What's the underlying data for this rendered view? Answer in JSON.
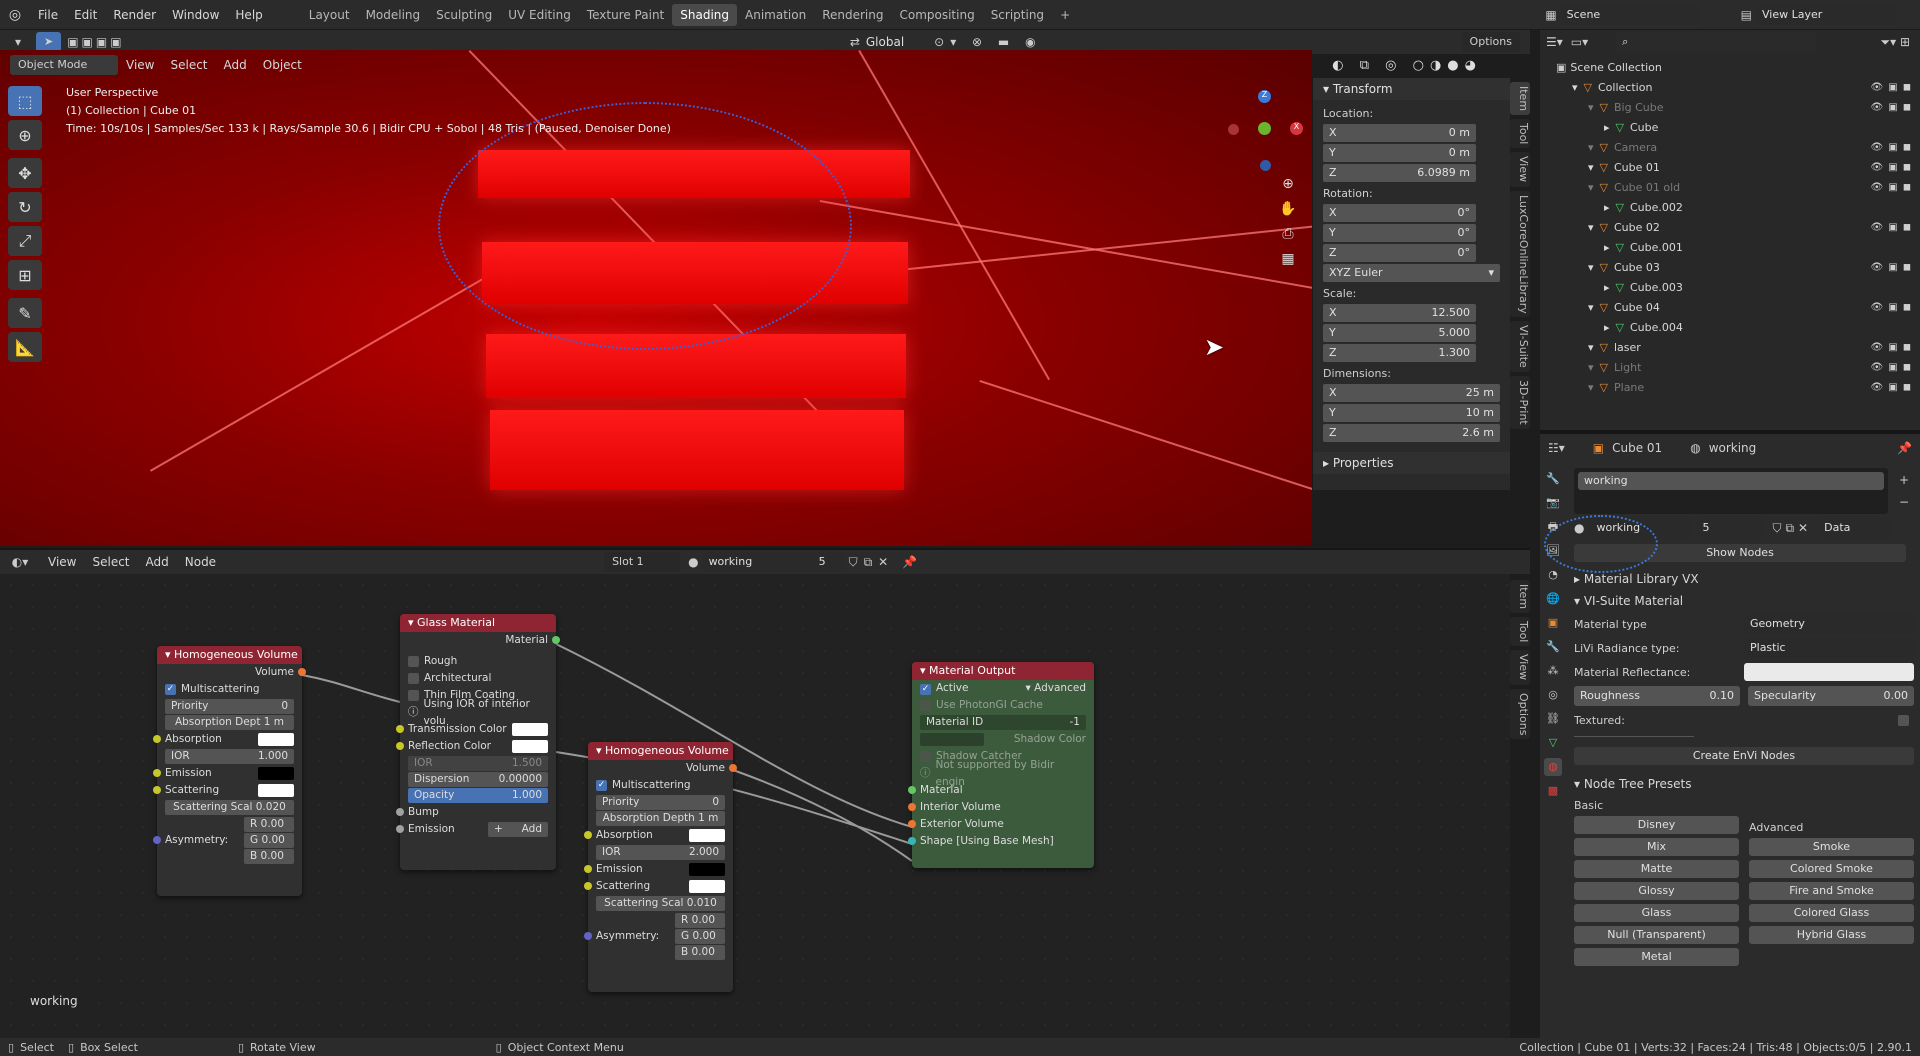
{
  "menu": {
    "items": [
      "File",
      "Edit",
      "Render",
      "Window",
      "Help"
    ]
  },
  "workspaces": [
    "Layout",
    "Modeling",
    "Sculpting",
    "UV Editing",
    "Texture Paint",
    "Shading",
    "Animation",
    "Rendering",
    "Compositing",
    "Scripting"
  ],
  "scene": {
    "scene_name": "Scene",
    "view_layer": "View Layer"
  },
  "viewport": {
    "mode": "Object Mode",
    "menus": [
      "View",
      "Select",
      "Add",
      "Object"
    ],
    "orientation": "Global",
    "options": "Options",
    "line1": "User Perspective",
    "line2": "(1) Collection | Cube 01",
    "line3": "Time: 10s/10s | Samples/Sec 133 k | Rays/Sample 30.6 | Bidir CPU + Sobol | 48 Tris | (Paused, Denoiser Done)"
  },
  "transform": {
    "title": "Transform",
    "location": "Location:",
    "loc": [
      "0 m",
      "0 m",
      "6.0989 m"
    ],
    "rotation": "Rotation:",
    "rot": [
      "0°",
      "0°",
      "0°"
    ],
    "euler": "XYZ Euler",
    "scale": "Scale:",
    "scl": [
      "12.500",
      "5.000",
      "1.300"
    ],
    "dimensions": "Dimensions:",
    "dim": [
      "25 m",
      "10 m",
      "2.6 m"
    ],
    "properties": "Properties",
    "axes": [
      "X",
      "Y",
      "Z"
    ]
  },
  "side_tabs": [
    "Item",
    "Tool",
    "View",
    "LuxCoreOnlineLibrary",
    "VI-Suite",
    "3D-Print"
  ],
  "node_side_tabs": [
    "Item",
    "Tool",
    "View",
    "Options"
  ],
  "node_header": {
    "menus": [
      "View",
      "Select",
      "Add",
      "Node"
    ],
    "slot": "Slot 1",
    "material": "working",
    "users": "5"
  },
  "node_editor_label": "working",
  "nodes": {
    "hv1": {
      "title": "Homogeneous Volume",
      "volume": "Volume",
      "multiscattering": "Multiscattering",
      "priority_l": "Priority",
      "priority_v": "0",
      "absdepth": "Absorption Dept  1 m",
      "absorption": "Absorption",
      "ior_l": "IOR",
      "ior_v": "1.000",
      "emission": "Emission",
      "scattering": "Scattering",
      "scatscale": "Scattering Scal  0.020",
      "asym": "Asymmetry:",
      "r": "R  0.00",
      "g": "G  0.00",
      "b": "B  0.00"
    },
    "glass": {
      "title": "Glass Material",
      "material": "Material",
      "rough": "Rough",
      "arch": "Architectural",
      "thin": "Thin Film Coating",
      "info": "Using IOR of interior volu",
      "trans": "Transmission Color",
      "refl": "Reflection Color",
      "ior_l": "IOR",
      "ior_v": "1.500",
      "disp_l": "Dispersion",
      "disp_v": "0.00000",
      "opac_l": "Opacity",
      "opac_v": "1.000",
      "bump": "Bump",
      "emission": "Emission",
      "add": "Add"
    },
    "hv2": {
      "title": "Homogeneous Volume",
      "volume": "Volume",
      "multiscattering": "Multiscattering",
      "priority_l": "Priority",
      "priority_v": "0",
      "absdepth": "Absorption Depth  1 m",
      "absorption": "Absorption",
      "ior_l": "IOR",
      "ior_v": "2.000",
      "emission": "Emission",
      "scattering": "Scattering",
      "scatscale": "Scattering Scal  0.010",
      "asym": "Asymmetry:",
      "r": "R  0.00",
      "g": "G  0.00",
      "b": "B  0.00"
    },
    "out": {
      "title": "Material Output",
      "active": "Active",
      "advanced": "Advanced",
      "photongi": "Use PhotonGI Cache",
      "matid_l": "Material ID",
      "matid_v": "-1",
      "shadow": "Shadow Color",
      "catcher": "Shadow Catcher",
      "notsup": "Not supported by Bidir engin",
      "material": "Material",
      "interior": "Interior Volume",
      "exterior": "Exterior Volume",
      "shape": "Shape [Using Base Mesh]"
    }
  },
  "outliner": {
    "root": "Scene Collection",
    "rows": [
      {
        "name": "Collection",
        "indent": 1,
        "dim": false
      },
      {
        "name": "Big Cube",
        "indent": 2,
        "dim": true
      },
      {
        "name": "Cube",
        "indent": 3,
        "dim": false
      },
      {
        "name": "Camera",
        "indent": 2,
        "dim": true
      },
      {
        "name": "Cube 01",
        "indent": 2,
        "dim": false
      },
      {
        "name": "Cube 01 old",
        "indent": 2,
        "dim": true
      },
      {
        "name": "Cube.002",
        "indent": 3,
        "dim": false
      },
      {
        "name": "Cube 02",
        "indent": 2,
        "dim": false
      },
      {
        "name": "Cube.001",
        "indent": 3,
        "dim": false
      },
      {
        "name": "Cube 03",
        "indent": 2,
        "dim": false
      },
      {
        "name": "Cube.003",
        "indent": 3,
        "dim": false
      },
      {
        "name": "Cube 04",
        "indent": 2,
        "dim": false
      },
      {
        "name": "Cube.004",
        "indent": 3,
        "dim": false
      },
      {
        "name": "laser",
        "indent": 2,
        "dim": false
      },
      {
        "name": "Light",
        "indent": 2,
        "dim": true
      },
      {
        "name": "Plane",
        "indent": 2,
        "dim": true
      }
    ]
  },
  "props": {
    "object": "Cube 01",
    "material": "working",
    "slot_name": "working",
    "mat_field": "working",
    "users": "5",
    "data": "Data",
    "show_nodes": "Show Nodes",
    "matlib": "Material Library VX",
    "visuite": "VI-Suite Material",
    "mattype_l": "Material type",
    "mattype_v": "Geometry",
    "livi_l": "LiVi Radiance type:",
    "livi_v": "Plastic",
    "reflect_l": "Material Reflectance:",
    "rough_l": "Roughness",
    "rough_v": "0.10",
    "spec_l": "Specularity",
    "spec_v": "0.00",
    "textured": "Textured:",
    "create": "Create EnVi Nodes",
    "presets": "Node Tree Presets",
    "basic": "Basic",
    "advanced": "Advanced",
    "basic_items": [
      "Disney",
      "Mix",
      "Matte",
      "Glossy",
      "Glass",
      "Null (Transparent)",
      "Metal"
    ],
    "adv_items": [
      "Smoke",
      "Colored Smoke",
      "Fire and Smoke",
      "Colored Glass",
      "Hybrid Glass"
    ]
  },
  "status": {
    "select": "Select",
    "box": "Box Select",
    "rotate": "Rotate View",
    "context": "Object Context Menu",
    "info": "Collection | Cube 01 | Verts:32 | Faces:24 | Tris:48 | Objects:0/5 | 2.90.1"
  }
}
